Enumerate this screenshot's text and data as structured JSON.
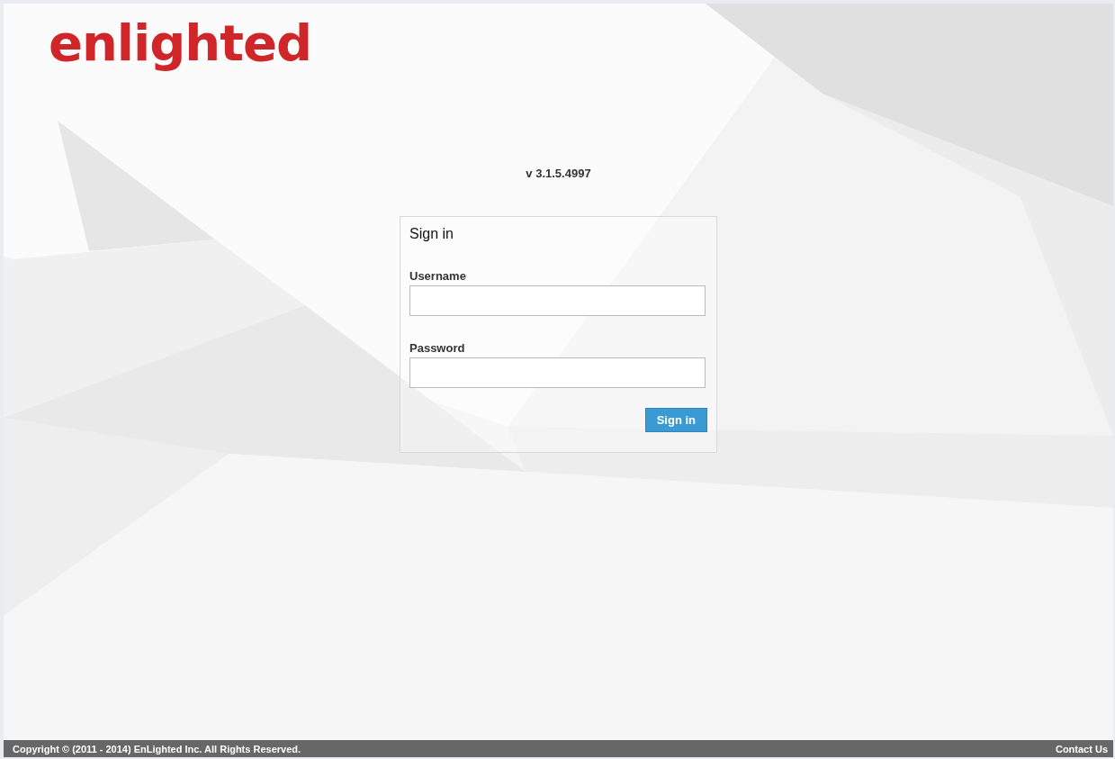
{
  "logo": {
    "text": "enlighted"
  },
  "version": "v 3.1.5.4997",
  "sign_in": {
    "title": "Sign in",
    "fields": [
      {
        "label": "Username"
      },
      {
        "label": "Password"
      }
    ],
    "button": "Sign in"
  },
  "footer": {
    "copyright": "Copyright © (2011 - 2014) EnLighted Inc. All Rights Reserved.",
    "contact": "Contact Us"
  }
}
